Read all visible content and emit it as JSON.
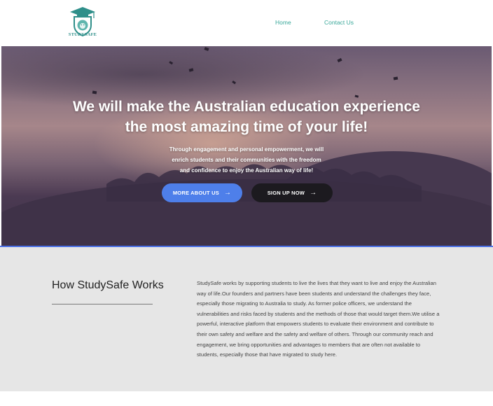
{
  "header": {
    "logo_text": "STUDYSAFE",
    "nav": [
      {
        "label": "Home"
      },
      {
        "label": "Contact Us"
      }
    ]
  },
  "hero": {
    "title_line1": "We will make the Australian education experience",
    "title_line2": "the most amazing time of your life!",
    "sub_line1": "Through engagement and personal empowerment, we will",
    "sub_line2": "enrich students and their communities with the freedom",
    "sub_line3": "and confidence to enjoy the Australian way of life!",
    "more_button": "MORE ABOUT US",
    "signup_button": "SIGN UP NOW",
    "arrow_glyph": "→"
  },
  "works": {
    "title": "How StudySafe Works",
    "body": "StudySafe works by supporting students to live the lives that they want to live and enjoy the Australian way of life.Our founders and partners have been students and understand the challenges they face, especially those migrating to Australia to study. As former police officers, we understand the vulnerabilities and risks faced by students and the methods of those that would target them.We utilise a powerful, interactive platform that empowers students to evaluate their environment and contribute to their own safety and welfare and the safety and welfare of others. Through our community reach and engagement, we bring opportunities and advantages to members that are often not available to students, especially those that have migrated to study here."
  },
  "colors": {
    "accent": "#4e7fea",
    "nav_link": "#3aa89a",
    "logo_teal": "#2f8f8a",
    "dark_button": "#1c1a1f",
    "section_bg": "#e6e6e6"
  },
  "icons": {
    "logo": "graduation-cap-lion-shield-icon",
    "button_arrow": "arrow-right-icon"
  }
}
